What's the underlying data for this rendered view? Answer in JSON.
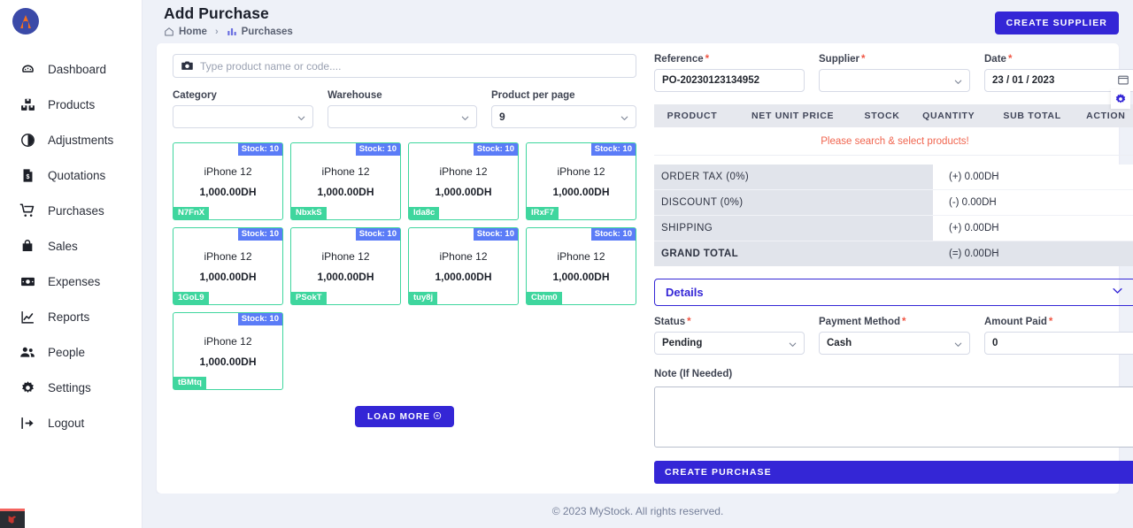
{
  "sidebar": {
    "logo_name": "flame-logo",
    "items": [
      {
        "label": "Dashboard",
        "icon": "dashboard-icon"
      },
      {
        "label": "Products",
        "icon": "products-icon"
      },
      {
        "label": "Adjustments",
        "icon": "adjustments-icon"
      },
      {
        "label": "Quotations",
        "icon": "quotations-icon"
      },
      {
        "label": "Purchases",
        "icon": "purchases-cart-icon"
      },
      {
        "label": "Sales",
        "icon": "sales-bag-icon"
      },
      {
        "label": "Expenses",
        "icon": "expenses-money-icon"
      },
      {
        "label": "Reports",
        "icon": "reports-chart-icon"
      },
      {
        "label": "People",
        "icon": "people-icon"
      },
      {
        "label": "Settings",
        "icon": "settings-gear-icon"
      },
      {
        "label": "Logout",
        "icon": "logout-icon"
      }
    ]
  },
  "header": {
    "title": "Add Purchase",
    "breadcrumb": {
      "home": "Home",
      "separator": "›",
      "current": "Purchases"
    },
    "create_supplier_label": "CREATE SUPPLIER"
  },
  "search": {
    "placeholder": "Type product name or code....",
    "value": ""
  },
  "filters": {
    "category": {
      "label": "Category",
      "value": ""
    },
    "warehouse": {
      "label": "Warehouse",
      "value": ""
    },
    "product_per_page": {
      "label": "Product per page",
      "value": "9"
    }
  },
  "products": {
    "stock_prefix": "Stock: ",
    "items": [
      {
        "name": "iPhone 12",
        "price": "1,000.00DH",
        "stock": "Stock: 10",
        "code": "N7FnX"
      },
      {
        "name": "iPhone 12",
        "price": "1,000.00DH",
        "stock": "Stock: 10",
        "code": "NbxkS"
      },
      {
        "name": "iPhone 12",
        "price": "1,000.00DH",
        "stock": "Stock: 10",
        "code": "Ida8c"
      },
      {
        "name": "iPhone 12",
        "price": "1,000.00DH",
        "stock": "Stock: 10",
        "code": "IRxF7"
      },
      {
        "name": "iPhone 12",
        "price": "1,000.00DH",
        "stock": "Stock: 10",
        "code": "1GoL9"
      },
      {
        "name": "iPhone 12",
        "price": "1,000.00DH",
        "stock": "Stock: 10",
        "code": "PSokT"
      },
      {
        "name": "iPhone 12",
        "price": "1,000.00DH",
        "stock": "Stock: 10",
        "code": "tuy8j"
      },
      {
        "name": "iPhone 12",
        "price": "1,000.00DH",
        "stock": "Stock: 10",
        "code": "Cbtm0"
      },
      {
        "name": "iPhone 12",
        "price": "1,000.00DH",
        "stock": "Stock: 10",
        "code": "tBMtq"
      }
    ],
    "load_more_label": "LOAD MORE"
  },
  "order": {
    "reference": {
      "label": "Reference",
      "required": "*",
      "value": "PO-20230123134952"
    },
    "supplier": {
      "label": "Supplier",
      "required": "*",
      "value": ""
    },
    "date": {
      "label": "Date",
      "required": "*",
      "value": "23 / 01 / 2023"
    }
  },
  "product_table": {
    "headers": [
      "PRODUCT",
      "NET UNIT PRICE",
      "STOCK",
      "QUANTITY",
      "SUB TOTAL",
      "ACTION"
    ],
    "empty_message": "Please search & select products!"
  },
  "totals": [
    {
      "label": "ORDER TAX (0%)",
      "value": "(+) 0.00DH"
    },
    {
      "label": "DISCOUNT (0%)",
      "value": "(-) 0.00DH"
    },
    {
      "label": "SHIPPING",
      "value": "(+) 0.00DH"
    },
    {
      "label": "GRAND TOTAL",
      "value": "(=) 0.00DH"
    }
  ],
  "details": {
    "title": "Details",
    "status": {
      "label": "Status",
      "required": "*",
      "value": "Pending"
    },
    "payment_method": {
      "label": "Payment Method",
      "required": "*",
      "value": "Cash"
    },
    "amount_paid": {
      "label": "Amount Paid",
      "required": "*",
      "value": "0"
    },
    "note": {
      "label": "Note (If Needed)",
      "value": ""
    },
    "create_purchase_label": "CREATE PURCHASE"
  },
  "footer": {
    "text": "© 2023 MyStock. All rights reserved."
  },
  "colors": {
    "primary": "#3426d6",
    "card_border_green": "#3fd69e",
    "stock_badge_blue": "#5b7cf7",
    "error_red": "#f0654f",
    "page_bg": "#eef1f8"
  }
}
